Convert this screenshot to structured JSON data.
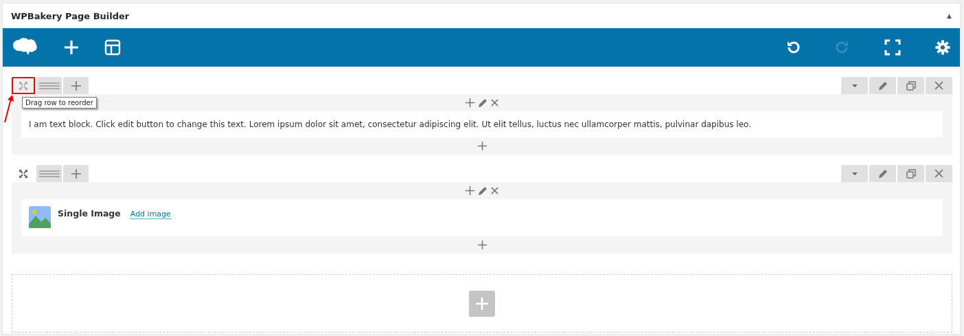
{
  "panel": {
    "title": "WPBakery Page Builder",
    "collapse_glyph": "▲"
  },
  "toolbar": {
    "left": [
      {
        "kind": "logo",
        "disabled": false
      },
      {
        "kind": "add",
        "disabled": false
      },
      {
        "kind": "templates",
        "disabled": false
      }
    ],
    "right": [
      {
        "kind": "undo",
        "disabled": false
      },
      {
        "kind": "redo",
        "disabled": true
      },
      {
        "kind": "fullscreen",
        "disabled": false
      },
      {
        "kind": "settings",
        "disabled": false
      }
    ]
  },
  "rows": [
    {
      "handle_highlighted": true,
      "tooltip": "Drag row to reorder",
      "elements": [
        {
          "kind": "text",
          "text": "I am text block. Click edit button to change this text. Lorem ipsum dolor sit amet, consectetur adipiscing elit. Ut elit tellus, luctus nec ullamcorper mattis, pulvinar dapibus leo."
        }
      ]
    },
    {
      "handle_highlighted": false,
      "elements": [
        {
          "kind": "image",
          "title": "Single Image",
          "link": "Add image"
        }
      ]
    }
  ]
}
